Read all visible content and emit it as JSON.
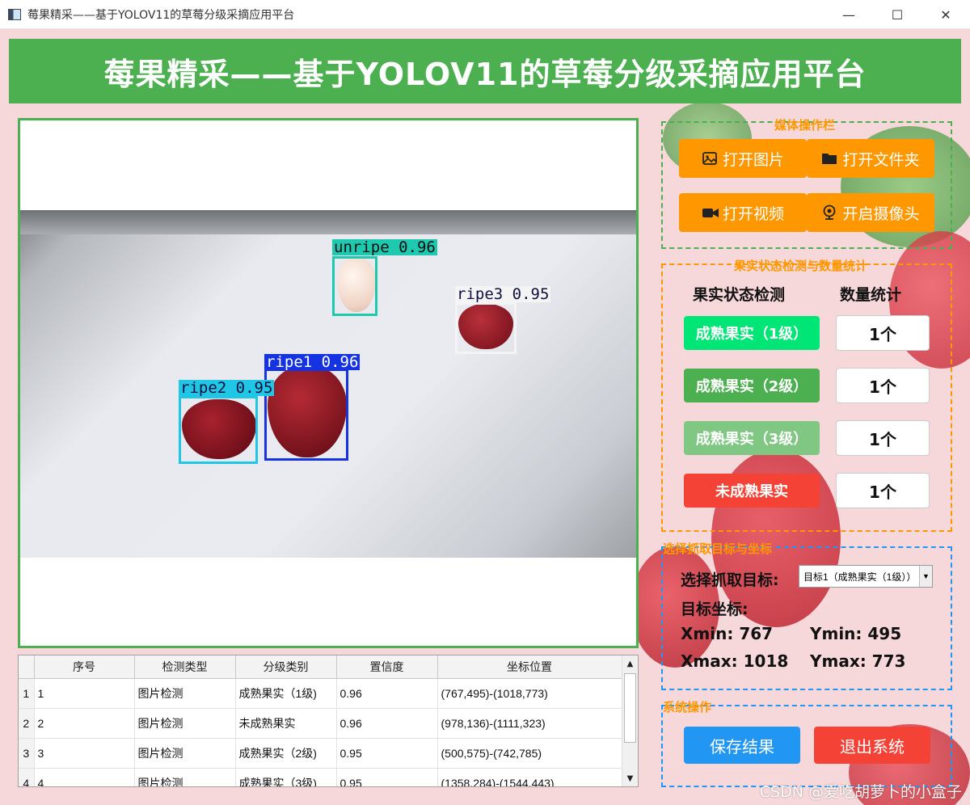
{
  "window": {
    "title": "莓果精采——基于YOLOV11的草莓分级采摘应用平台",
    "minimize": "—",
    "maximize": "☐",
    "close": "✕"
  },
  "header": {
    "title": "莓果精采——基于YOLOV11的草莓分级采摘应用平台"
  },
  "detections": [
    {
      "label": "unripe  0.96",
      "color": "#1ec9b0",
      "text_color": "#101010"
    },
    {
      "label": "ripe3  0.95",
      "color": "#f4f4f4",
      "text_color": "#101040"
    },
    {
      "label": "ripe1  0.96",
      "color": "#1533e0",
      "text_color": "#ffffff"
    },
    {
      "label": "ripe2  0.95",
      "color": "#20c6e6",
      "text_color": "#101040"
    }
  ],
  "table": {
    "headers": [
      "序号",
      "检测类型",
      "分级类别",
      "置信度",
      "坐标位置"
    ],
    "rows": [
      {
        "row_num": "1",
        "id": "1",
        "type": "图片检测",
        "grade": "成熟果实（1级)",
        "conf": "0.96",
        "coords": "(767,495)-(1018,773)"
      },
      {
        "row_num": "2",
        "id": "2",
        "type": "图片检测",
        "grade": "未成熟果实",
        "conf": "0.96",
        "coords": "(978,136)-(1111,323)"
      },
      {
        "row_num": "3",
        "id": "3",
        "type": "图片检测",
        "grade": "成熟果实（2级)",
        "conf": "0.95",
        "coords": "(500,575)-(742,785)"
      },
      {
        "row_num": "4",
        "id": "4",
        "type": "图片检测",
        "grade": "成熟果实（3级)",
        "conf": "0.95",
        "coords": "(1358,284)-(1544,443)"
      }
    ]
  },
  "media_panel": {
    "title": "媒体操作栏",
    "open_image": "打开图片",
    "open_folder": "打开文件夹",
    "open_video": "打开视频",
    "open_camera": "开启摄像头"
  },
  "stats_panel": {
    "title": "果实状态检测与数量统计",
    "col_state": "果实状态检测",
    "col_count": "数量统计",
    "items": [
      {
        "label": "成熟果实（1级）",
        "count": "1个",
        "color": "#00e676"
      },
      {
        "label": "成熟果实（2级）",
        "count": "1个",
        "color": "#4caf50"
      },
      {
        "label": "成熟果实（3级）",
        "count": "1个",
        "color": "#81c784"
      },
      {
        "label": "未成熟果实",
        "count": "1个",
        "color": "#f44336"
      }
    ]
  },
  "target_panel": {
    "title": "选择抓取目标与坐标",
    "select_label": "选择抓取目标:",
    "select_value": "目标1（成熟果实（1级））",
    "coords_label": "目标坐标:",
    "xmin": "Xmin: 767",
    "ymin": "Ymin: 495",
    "xmax": "Xmax: 1018",
    "ymax": "Ymax: 773"
  },
  "system_panel": {
    "title": "系统操作",
    "save": "保存结果",
    "exit": "退出系统"
  },
  "watermark": "CSDN @爱吃胡萝卜的小盒子",
  "colors": {
    "accent_green": "#4caf50",
    "accent_orange": "#ff9800",
    "accent_blue": "#2196f3",
    "accent_red": "#f44336",
    "background": "#f6d7da"
  }
}
